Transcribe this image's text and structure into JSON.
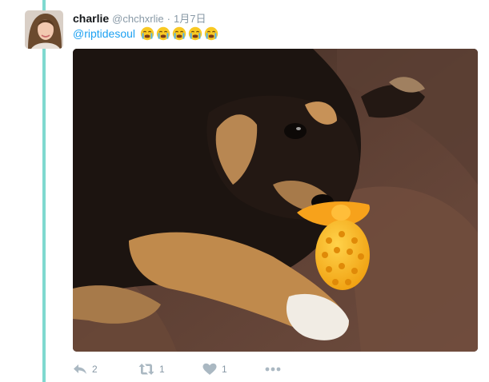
{
  "tweet": {
    "author_name": "charlie",
    "handle": "@chchxrlie",
    "separator": "·",
    "date": "1月7日",
    "mention": "@riptidesoul",
    "emoji_icon": "loudly-crying-face-icon",
    "emoji_count": 5,
    "media_alt": "puppy chewing orange toy"
  },
  "actions": {
    "reply_count": "2",
    "retweet_count": "1",
    "like_count": "1"
  },
  "colors": {
    "thread_line": "#7fd9cf",
    "mention": "#1da1f2",
    "muted": "#8899a6",
    "icon": "#aab8c2"
  }
}
